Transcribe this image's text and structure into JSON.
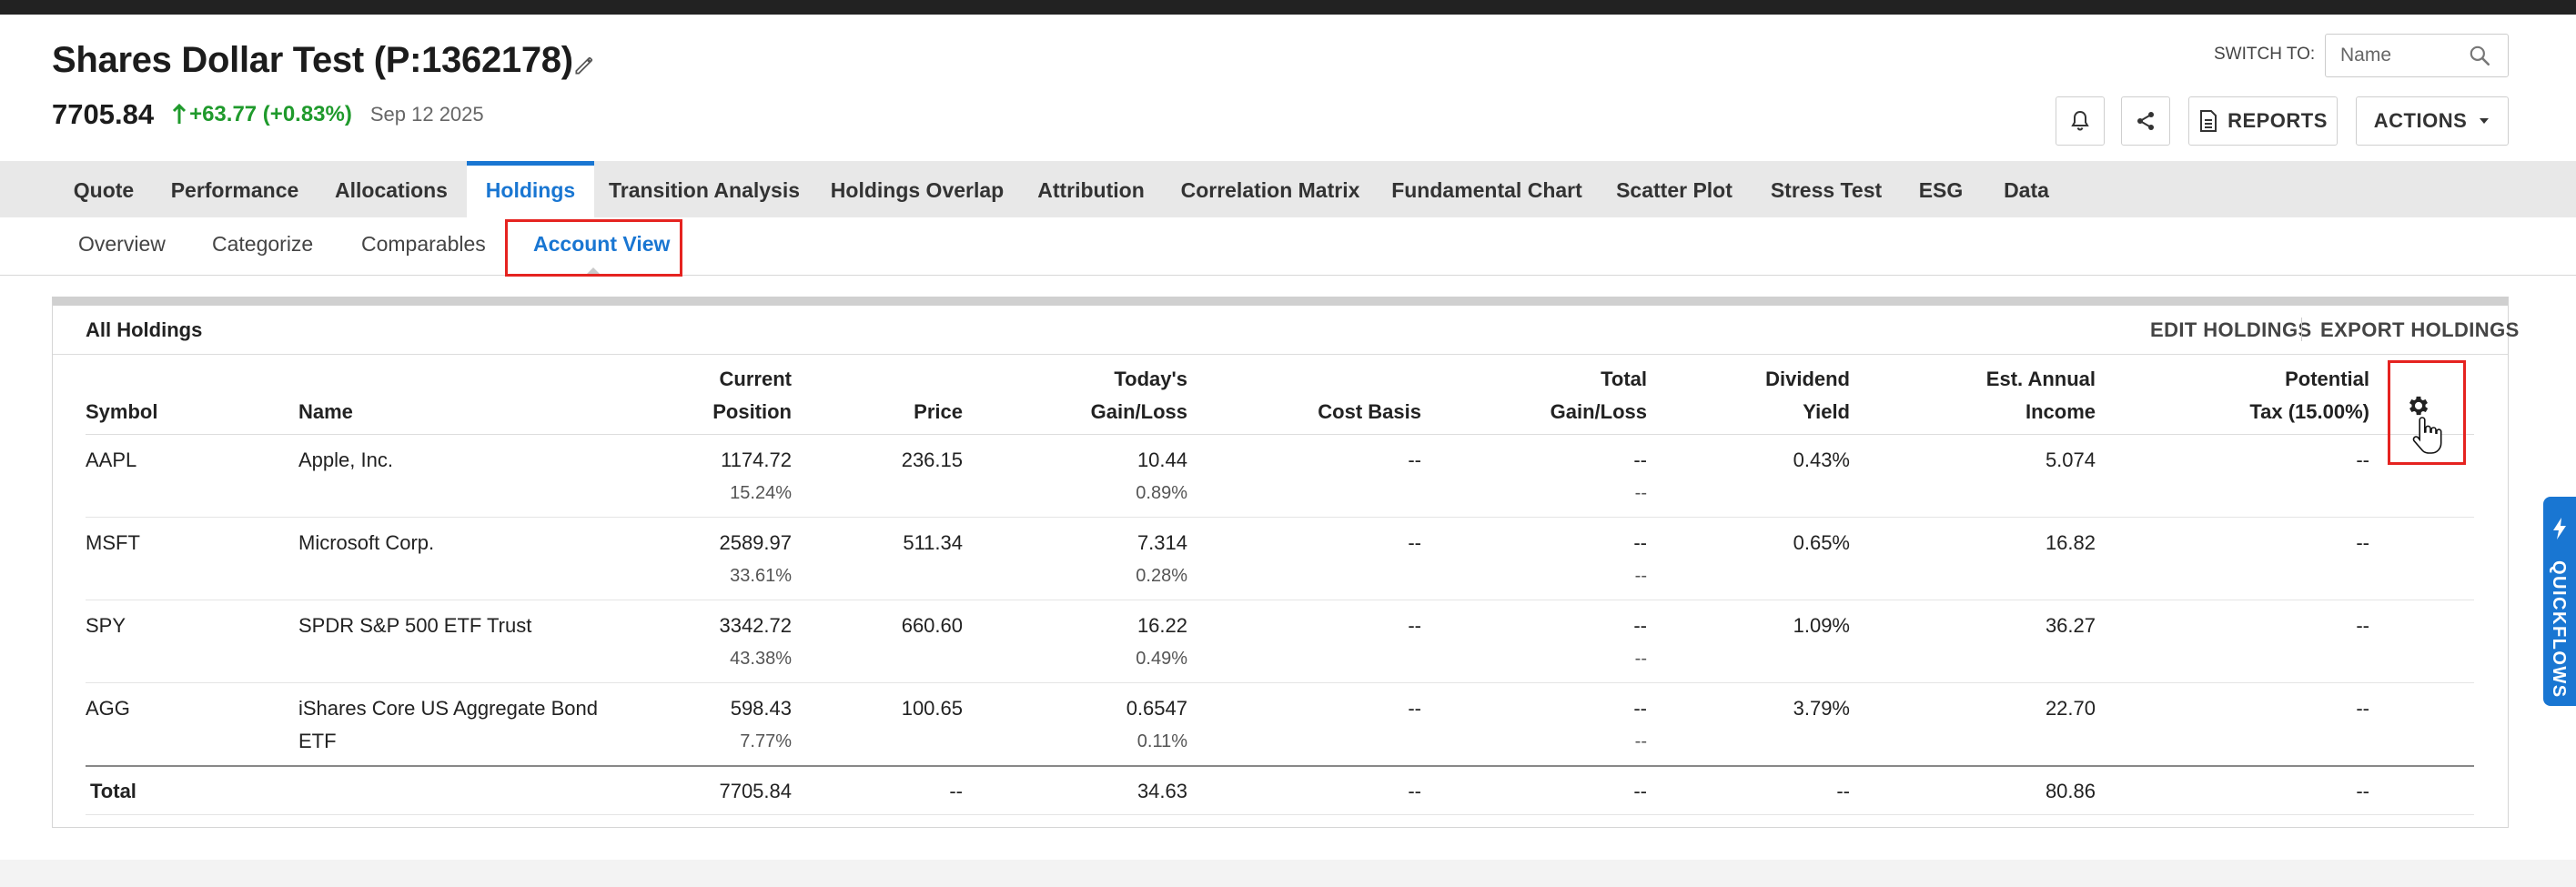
{
  "header": {
    "title": "Shares Dollar Test (P:1362178)",
    "price": "7705.84",
    "change": "+63.77 (+0.83%)",
    "date": "Sep 12 2025",
    "switch_label": "SWITCH TO:",
    "switch_placeholder": "Name",
    "reports_label": "REPORTS",
    "actions_label": "ACTIONS",
    "change_color": "#1f9a2c"
  },
  "icons": {
    "edit": "pencil-icon",
    "up": "arrow-up-icon",
    "search": "search-icon",
    "alert": "bell-icon",
    "share": "share-icon",
    "reports": "document-icon",
    "actions": "caret-down-icon",
    "settings": "gear-icon",
    "cursor": "hand-pointer-icon",
    "quickflows": "lightning-icon"
  },
  "tabs": [
    {
      "label": "Quote"
    },
    {
      "label": "Performance"
    },
    {
      "label": "Allocations"
    },
    {
      "label": "Holdings",
      "active": true
    },
    {
      "label": "Transition Analysis"
    },
    {
      "label": "Holdings Overlap"
    },
    {
      "label": "Attribution"
    },
    {
      "label": "Correlation Matrix"
    },
    {
      "label": "Fundamental Chart"
    },
    {
      "label": "Scatter Plot"
    },
    {
      "label": "Stress Test"
    },
    {
      "label": "ESG"
    },
    {
      "label": "Data"
    }
  ],
  "subtabs": [
    {
      "label": "Overview"
    },
    {
      "label": "Categorize"
    },
    {
      "label": "Comparables"
    },
    {
      "label": "Account View",
      "active": true
    }
  ],
  "panel": {
    "title": "All Holdings",
    "edit_label": "EDIT HOLDINGS",
    "export_label": "EXPORT HOLDINGS"
  },
  "table": {
    "headers": {
      "symbol": "Symbol",
      "name": "Name",
      "position_1": "Current",
      "position_2": "Position",
      "price": "Price",
      "gain_1": "Today's",
      "gain_2": "Gain/Loss",
      "cost": "Cost Basis",
      "total_gain_1": "Total",
      "total_gain_2": "Gain/Loss",
      "yield_1": "Dividend",
      "yield_2": "Yield",
      "income_1": "Est. Annual",
      "income_2": "Income",
      "tax_1": "Potential",
      "tax_2": "Tax (15.00%)"
    },
    "rows": [
      {
        "symbol": "AAPL",
        "name": "Apple, Inc.",
        "name2": "",
        "position": "1174.72",
        "position_pct": "15.24%",
        "price": "236.15",
        "gain": "10.44",
        "gain_pct": "0.89%",
        "cost": "--",
        "total_gain": "--",
        "total_gain_pct": "--",
        "yield": "0.43%",
        "income": "5.074",
        "tax": "--"
      },
      {
        "symbol": "MSFT",
        "name": "Microsoft Corp.",
        "name2": "",
        "position": "2589.97",
        "position_pct": "33.61%",
        "price": "511.34",
        "gain": "7.314",
        "gain_pct": "0.28%",
        "cost": "--",
        "total_gain": "--",
        "total_gain_pct": "--",
        "yield": "0.65%",
        "income": "16.82",
        "tax": "--"
      },
      {
        "symbol": "SPY",
        "name": "SPDR S&P 500 ETF Trust",
        "name2": "",
        "position": "3342.72",
        "position_pct": "43.38%",
        "price": "660.60",
        "gain": "16.22",
        "gain_pct": "0.49%",
        "cost": "--",
        "total_gain": "--",
        "total_gain_pct": "--",
        "yield": "1.09%",
        "income": "36.27",
        "tax": "--"
      },
      {
        "symbol": "AGG",
        "name": "iShares Core US Aggregate Bond",
        "name2": "ETF",
        "position": "598.43",
        "position_pct": "7.77%",
        "price": "100.65",
        "gain": "0.6547",
        "gain_pct": "0.11%",
        "cost": "--",
        "total_gain": "--",
        "total_gain_pct": "--",
        "yield": "3.79%",
        "income": "22.70",
        "tax": "--"
      }
    ],
    "total": {
      "label": "Total",
      "position": "7705.84",
      "price": "--",
      "gain": "34.63",
      "cost": "--",
      "total_gain": "--",
      "yield": "--",
      "income": "80.86",
      "tax": "--"
    }
  },
  "quickflows": {
    "label": "QUICKFLOWS",
    "color": "#1976d2"
  }
}
